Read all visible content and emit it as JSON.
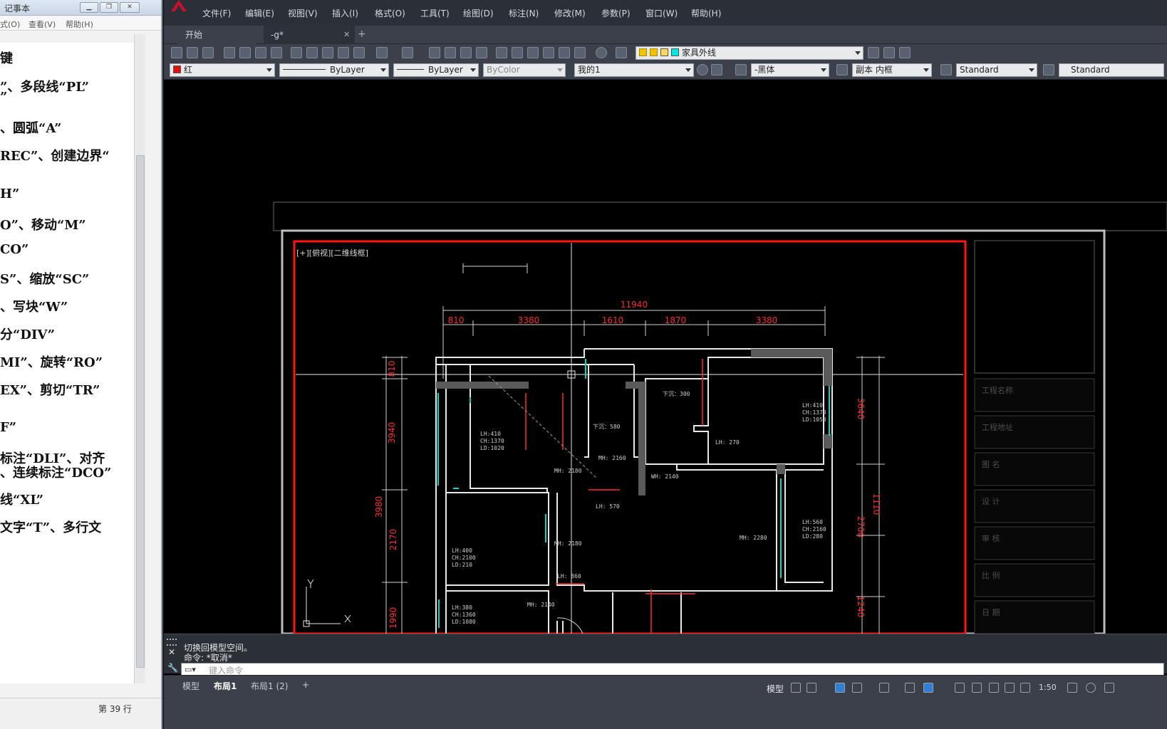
{
  "notepad": {
    "title": "记事本",
    "menu": [
      "式(O)",
      "查看(V)",
      "帮助(H)"
    ],
    "lines": [
      "键",
      "”、多段线“PL”",
      "”",
      "、圆弧“A”",
      "REC”、创建边界“",
      "H”",
      "O”、移动“M”",
      "CO”",
      "S”、缩放“SC”",
      "、写块“W”",
      "分“DIV”",
      "MI”、旋转“RO”",
      "EX”、剪切“TR”",
      "F”",
      "标注“DLI”、对齐",
      "、连续标注“DCO”",
      "线“XL”",
      "文字“T”、多行文"
    ],
    "status": "第 39 行"
  },
  "cad": {
    "menu": [
      "文件(F)",
      "编辑(E)",
      "视图(V)",
      "插入(I)",
      "格式(O)",
      "工具(T)",
      "绘图(D)",
      "标注(N)",
      "修改(M)",
      "参数(P)",
      "窗口(W)",
      "帮助(H)"
    ],
    "tabs": {
      "start": "开始",
      "doc": "-g*"
    },
    "layer_dropdown": "家具外线",
    "properties": {
      "color": "红",
      "linetype": "ByLayer",
      "lineweight": "ByLayer",
      "plotstyle": "ByColor",
      "named_style": "我的1",
      "text_style": "-黑体",
      "dim_style": "副本 内框",
      "table_style": "Standard",
      "mleader_style": "Standard"
    },
    "viewport_label": "[+][俯视][二维线框]",
    "dimensions": {
      "overall": "11940",
      "top": [
        "810",
        "3380",
        "1610",
        "1870",
        "3380"
      ],
      "left": [
        "810",
        "3940",
        "3980",
        "2170",
        "1990"
      ],
      "right": [
        "3640",
        "1110",
        "2700",
        "1240"
      ]
    },
    "room_labels": [
      "下沉：300",
      "下沉：580",
      "LH:410",
      "CH:1370",
      "LD:1020",
      "LH:410",
      "CH:1370",
      "LD:1050",
      "LH: 270",
      "MH: 2160",
      "MH: 2180",
      "WH: 2140",
      "LH: 570",
      "LH:560",
      "CH:2160",
      "LD:280",
      "MH: 2280",
      "MH: 2180",
      "LH:400",
      "CH:2100",
      "LD:210",
      "LH: 860",
      "LH:380",
      "CH:1360",
      "LD:1080",
      "MH: 2140"
    ],
    "title_block": [
      "工程名称",
      "工程地址",
      "图 名",
      "设 计",
      "审 核",
      "比 例",
      "日 期"
    ],
    "command_history": [
      "切换回模型空间。",
      "命令: *取消*"
    ],
    "command_placeholder": "键入命令",
    "layout_tabs": [
      "模型",
      "布局1",
      "布局1 (2)"
    ],
    "status_model": "模型",
    "scale": "1:50"
  }
}
